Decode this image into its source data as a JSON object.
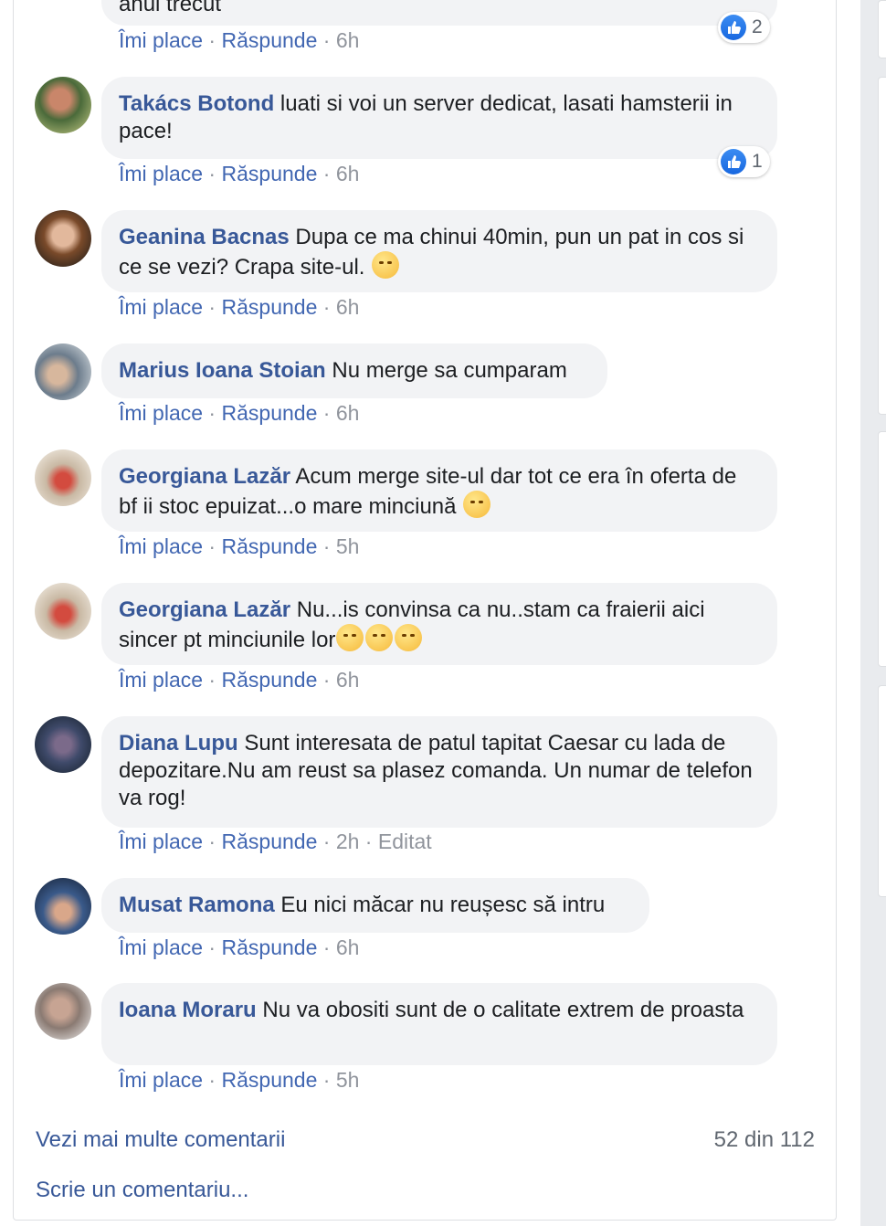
{
  "prev_comment": {
    "text_tail": "anul trecut",
    "actions": {
      "like": "Îmi place",
      "reply": "Răspunde",
      "time": "6h"
    },
    "reactions": "2"
  },
  "comments": [
    {
      "author": "Takács Botond",
      "text": "luati si voi un server dedicat, lasati hamsterii in pace!",
      "like": "Îmi place",
      "reply": "Răspunde",
      "time": "6h",
      "reactions": "1"
    },
    {
      "author": "Geanina Bacnas",
      "text": "Dupa ce ma chinui 40min, pun un pat in cos si ce se vezi? Crapa site-ul.",
      "like": "Îmi place",
      "reply": "Răspunde",
      "time": "6h"
    },
    {
      "author": "Marius Ioana Stoian",
      "text": "Nu merge sa cumparam",
      "like": "Îmi place",
      "reply": "Răspunde",
      "time": "6h"
    },
    {
      "author": "Georgiana Lazăr",
      "text": "Acum merge site-ul dar tot ce era în oferta de bf ii stoc epuizat...o mare minciună",
      "like": "Îmi place",
      "reply": "Răspunde",
      "time": "5h"
    },
    {
      "author": "Georgiana Lazăr",
      "text": "Nu...is convinsa ca nu..stam ca fraierii aici sincer pt minciunile lor",
      "like": "Îmi place",
      "reply": "Răspunde",
      "time": "6h"
    },
    {
      "author": "Diana Lupu",
      "text": "Sunt interesata de patul tapitat Caesar cu lada de depozitare.Nu am reust sa plasez comanda. Un numar de telefon va rog!",
      "like": "Îmi place",
      "reply": "Răspunde",
      "time": "2h",
      "edited": "Editat"
    },
    {
      "author": "Musat Ramona",
      "text": "Eu nici măcar nu reușesc să intru",
      "like": "Îmi place",
      "reply": "Răspunde",
      "time": "6h"
    },
    {
      "author": "Ioana Moraru",
      "text": "Nu va obositi sunt de o calitate extrem de proasta",
      "like": "Îmi place",
      "reply": "Răspunde",
      "time": "5h"
    }
  ],
  "footer": {
    "more_comments": "Vezi mai multe comentarii",
    "count": "52 din 112",
    "write_comment": "Scrie un comentariu..."
  },
  "icons": {
    "like_reaction": "like-thumb-icon",
    "emoji_pensive": "pensive-emoji",
    "emoji_unamused": "unamused-emoji",
    "emoji_angry": "frowning-emoji"
  },
  "colors": {
    "author": "#385898",
    "action": "#4267b2",
    "meta": "#90949c",
    "bubble": "#f2f3f5"
  }
}
